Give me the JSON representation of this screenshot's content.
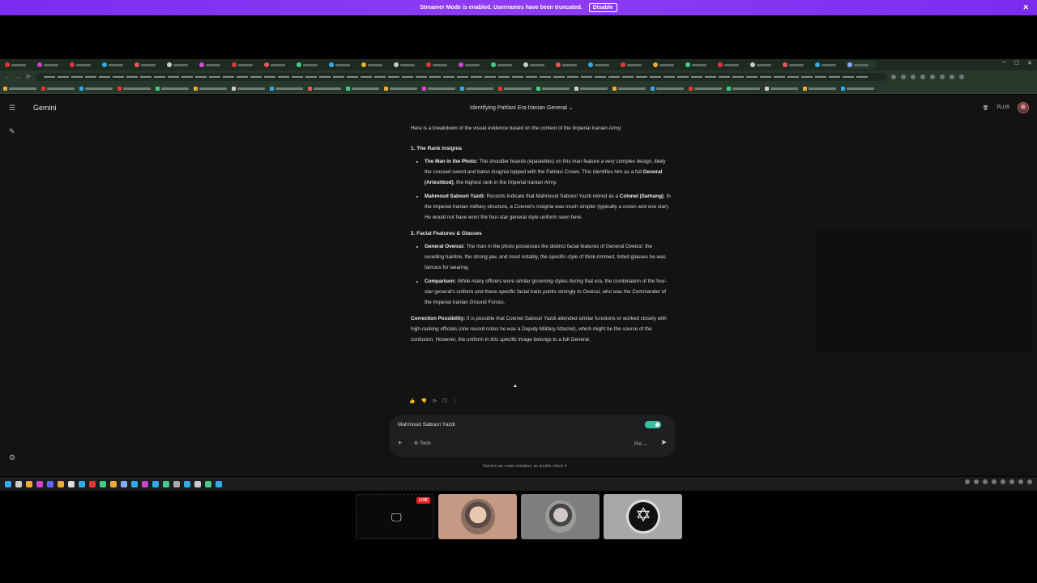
{
  "streamer_banner": {
    "message": "Streamer Mode is enabled. Usernames have been truncated.",
    "disable_label": "Disable",
    "close": "✕"
  },
  "app": {
    "brand": "Gemini",
    "conversation_title": "Identifying Pahlavi Era Iranian General",
    "plan_badge": "PLUS"
  },
  "chat": {
    "intro": "Here is a breakdown of the visual evidence based on the context of the Imperial Iranian Army:",
    "section1_heading": "1. The Rank Insignia",
    "s1_item1_label": "The Man in the Photo:",
    "s1_item1_text": " The shoulder boards (epaulettes) on this man feature a very complex design, likely the crossed sword and baton insignia topped with the Pahlavi Crown. This identifies him as a full ",
    "s1_item1_bold2": "General (Arteshbod)",
    "s1_item1_text2": ", the highest rank in the Imperial Iranian Army.",
    "s1_item2_label": "Mahmoud Sabouri Yazdi:",
    "s1_item2_text": " Records indicate that Mahmoud Sabouri Yazdi retired as a ",
    "s1_item2_bold2": "Colonel (Sarhang)",
    "s1_item2_text2": ". In the Imperial Iranian military structure, a Colonel's insignia was much simpler (typically a crown and one star). He would not have worn the four-star general style uniform seen here.",
    "section2_heading": "2. Facial Features & Glasses",
    "s2_item1_label": "General Oveissi:",
    "s2_item1_text": " The man in the photo possesses the distinct facial features of General Oveissi: the receding hairline, the strong jaw, and most notably, the specific style of thick-rimmed, tinted glasses he was famous for wearing.",
    "s2_item2_label": "Comparison:",
    "s2_item2_text": " While many officers wore similar grooming styles during that era, the combination of the four-star general's uniform and these specific facial traits points strongly to Oveissi, who was the Commander of the Imperial Iranian Ground Forces.",
    "correction_label": "Correction Possibility:",
    "correction_text": " It is possible that Colonel Sabouri Yazdi attended similar functions or worked closely with high-ranking officials (one record notes he was a Deputy Military Attaché), which might be the source of the confusion. However, the uniform in ",
    "correction_italic": "this specific image",
    "correction_text2": " belongs to a full General."
  },
  "input": {
    "value": "Mahmoud Sabouri Yazdi",
    "tools_label": "Tools",
    "model_label": "Pro"
  },
  "disclaimer": "Gemini can make mistakes, so double-check it",
  "stream": {
    "live_badge": "LIVE"
  },
  "colors": {
    "banner": "#8f3cf5",
    "app_bg": "#131314",
    "input_bg": "#1e1f20",
    "live": "#e22222"
  }
}
